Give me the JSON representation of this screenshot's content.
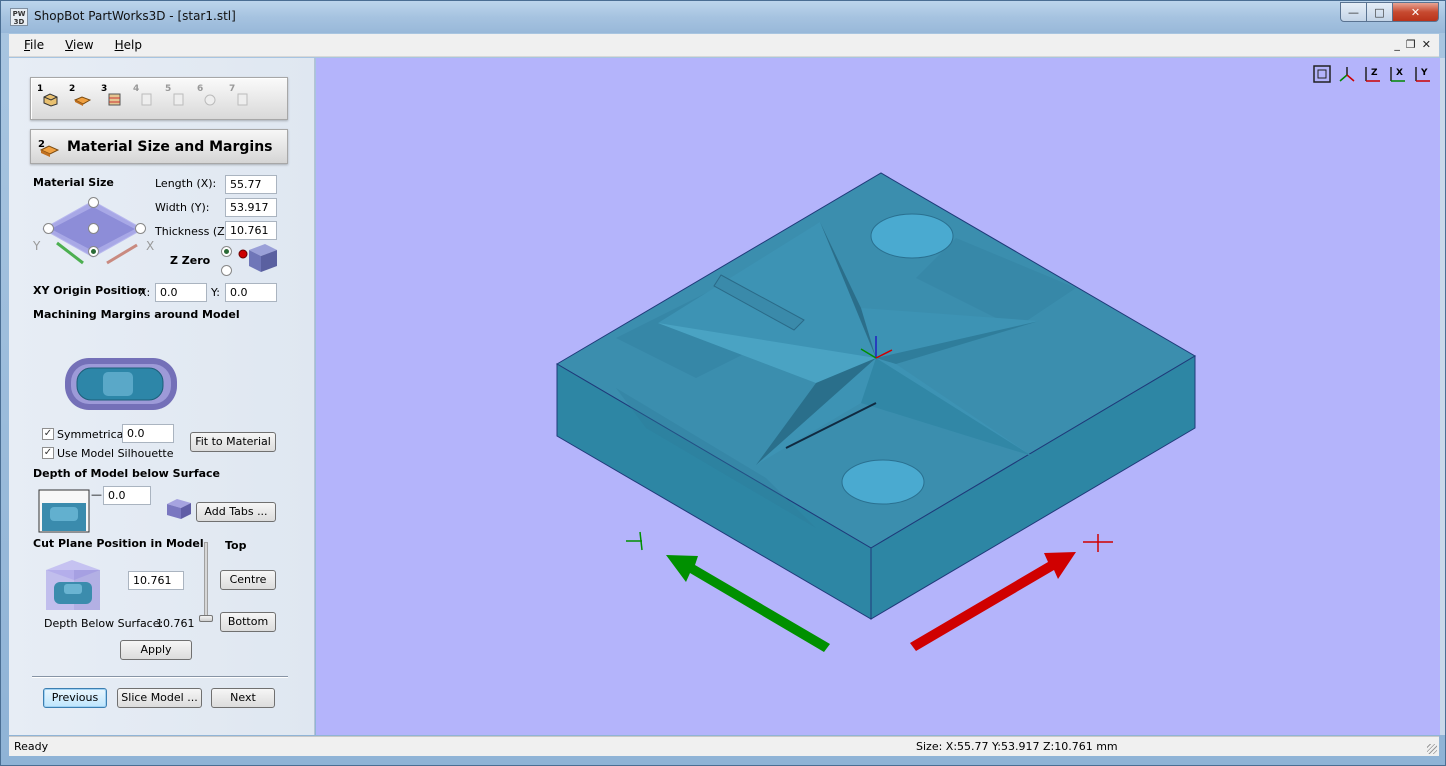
{
  "window": {
    "app_icon_text": "PW\n3D",
    "title": "ShopBot PartWorks3D - [star1.stl]",
    "minimize": "—",
    "maximize": "□",
    "close": "✕"
  },
  "menu": {
    "items": [
      "File",
      "View",
      "Help"
    ],
    "mdi_minimize": "_",
    "mdi_restore": "❐",
    "mdi_close": "✕"
  },
  "toolbar": {
    "steps": [
      {
        "num": "1",
        "icon": "box-icon"
      },
      {
        "num": "2",
        "icon": "material-size-icon"
      },
      {
        "num": "3",
        "icon": "slice-icon"
      },
      {
        "num": "4",
        "icon": "step4-icon"
      },
      {
        "num": "5",
        "icon": "step5-icon"
      },
      {
        "num": "6",
        "icon": "step6-icon"
      },
      {
        "num": "7",
        "icon": "step7-icon"
      }
    ]
  },
  "section": {
    "num": "2",
    "title": "Material Size and Margins"
  },
  "material": {
    "heading": "Material Size",
    "length_label": "Length (X):",
    "length_value": "55.77",
    "width_label": "Width (Y):",
    "width_value": "53.917",
    "thickness_label": "Thickness (Z):",
    "thickness_value": "10.761",
    "zzero_label": "Z Zero",
    "axis_y": "Y",
    "axis_x": "X"
  },
  "origin": {
    "label": "XY Origin Position",
    "x_label": "X:",
    "x_value": "0.0",
    "y_label": "Y:",
    "y_value": "0.0"
  },
  "margins": {
    "heading": "Machining Margins around Model",
    "symmetrical_label": "Symmetrical",
    "symmetrical_checked": true,
    "symmetrical_value": "0.0",
    "fit_button": "Fit to Material",
    "silhouette_label": "Use Model Silhouette",
    "silhouette_checked": true
  },
  "depth": {
    "heading": "Depth of Model below Surface",
    "value": "0.0",
    "add_tabs_button": "Add Tabs ..."
  },
  "cutplane": {
    "heading": "Cut Plane Position in Model",
    "value": "10.761",
    "top_label": "Top",
    "centre_button": "Centre",
    "bottom_button": "Bottom",
    "depth_label": "Depth Below Surface:",
    "depth_value": "10.761",
    "apply_button": "Apply",
    "slider_level": 0.0
  },
  "nav": {
    "previous": "Previous",
    "slice": "Slice Model ...",
    "next": "Next"
  },
  "view_icons": [
    "zoom-fit-icon",
    "iso-view-icon",
    "z-view-icon",
    "x-view-icon",
    "y-view-icon"
  ],
  "view_icon_labels": [
    "",
    "",
    "Z",
    "X",
    "Y"
  ],
  "status": {
    "left": "Ready",
    "right": "Size: X:55.77 Y:53.917 Z:10.761 mm"
  },
  "colors": {
    "viewport_bg": "#b4b4fb",
    "model_top": "#3a8fae",
    "model_side": "#2f86a3",
    "arrow_y": "#009000",
    "arrow_x": "#d00000"
  }
}
